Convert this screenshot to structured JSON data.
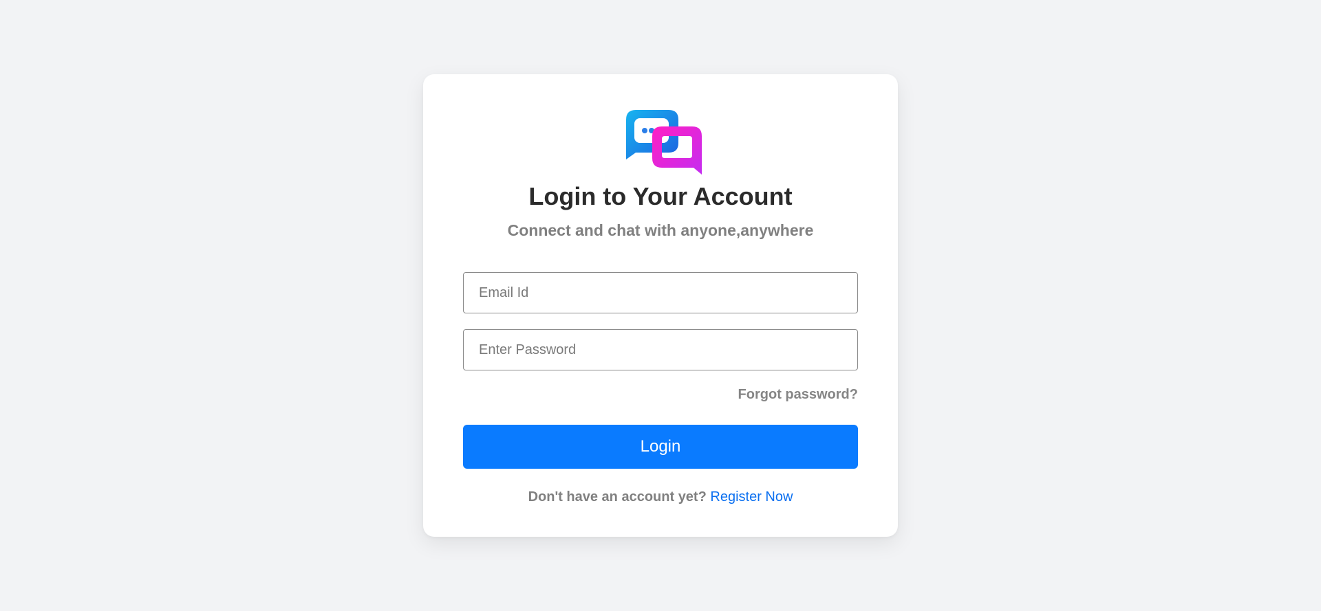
{
  "brand": {
    "logo_icon": "chat-bubbles-logo-icon",
    "colors": {
      "background": "#f2f3f5",
      "card": "#ffffff",
      "primary": "#0a7bff",
      "link": "#0a6ff0",
      "logo_blue": "#12a7ee",
      "logo_magenta": "#e91ecf"
    }
  },
  "login": {
    "title": "Login to Your Account",
    "subtitle": "Connect and chat with anyone,anywhere",
    "email_placeholder": "Email Id",
    "email_value": "",
    "password_placeholder": "Enter Password",
    "password_value": "",
    "forgot_label": "Forgot password?",
    "submit_label": "Login",
    "register_prompt": "Don't have an account yet?",
    "register_link": "Register Now"
  }
}
